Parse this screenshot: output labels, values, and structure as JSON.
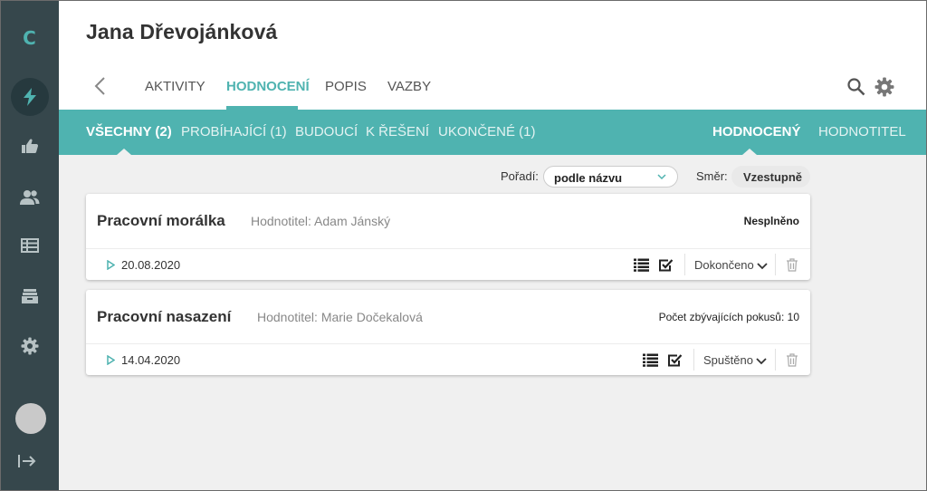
{
  "sidebar": {
    "logo": "C",
    "items": [
      {
        "icon": "lightning-icon",
        "active": true
      },
      {
        "icon": "thumbs-up-icon"
      },
      {
        "icon": "people-icon"
      },
      {
        "icon": "table-icon"
      },
      {
        "icon": "inbox-icon"
      },
      {
        "icon": "gear-icon"
      }
    ],
    "avatar": "avatar",
    "logout_icon": "logout-icon"
  },
  "header": {
    "person_name": "Jana Dřevojánková",
    "tabs": [
      {
        "label": "AKTIVITY"
      },
      {
        "label": "HODNOCENÍ",
        "active": true
      },
      {
        "label": "POPIS"
      },
      {
        "label": "VAZBY"
      }
    ]
  },
  "filters": {
    "tabs": [
      {
        "label": "VŠECHNY (2)",
        "active": true
      },
      {
        "label": "PROBÍHAJÍCÍ (1)"
      },
      {
        "label": "BUDOUCÍ"
      },
      {
        "label": "K ŘEŠENÍ"
      },
      {
        "label": "UKONČENÉ (1)"
      }
    ],
    "role_tabs": [
      {
        "label": "HODNOCENÝ",
        "active": true
      },
      {
        "label": "HODNOTITEL"
      }
    ]
  },
  "sort": {
    "order_label": "Pořadí:",
    "order_value": "podle názvu",
    "direction_label": "Směr:",
    "direction_value": "Vzestupně"
  },
  "cards": [
    {
      "title": "Pracovní morálka",
      "evaluator": "Hodnotitel: Adam Jánský",
      "status": "Nesplněno",
      "date": "20.08.2020",
      "state": "Dokončeno"
    },
    {
      "title": "Pracovní nasazení",
      "evaluator": "Hodnotitel: Marie Dočekalová",
      "status": "Počet zbývajících pokusů: 10",
      "date": "14.04.2020",
      "state": "Spuštěno"
    }
  ],
  "colors": {
    "accent": "#4fb3b0",
    "sidebar": "#36474c",
    "background": "#f0f0f0"
  }
}
